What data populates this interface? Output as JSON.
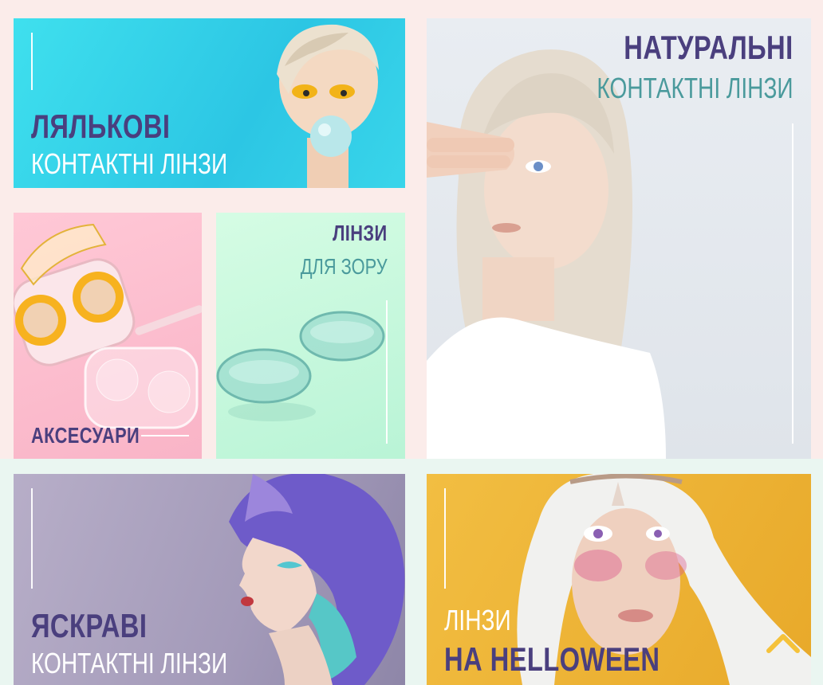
{
  "colors": {
    "title_purple": "#4a3f7e",
    "title_teal": "#4a9a9c",
    "white": "#ffffff",
    "accent_yellow": "#f5c23a"
  },
  "tiles": {
    "doll": {
      "line1": "ЛЯЛЬКОВІ",
      "line2": "КОНТАКТНІ ЛІНЗИ"
    },
    "natural": {
      "line1": "НАТУРАЛЬНІ",
      "line2": "КОНТАКТНІ ЛІНЗИ"
    },
    "accessories": {
      "line1": "АКСЕСУАРИ"
    },
    "vision": {
      "line1": "ЛІНЗИ",
      "line2": "ДЛЯ ЗОРУ"
    },
    "bright": {
      "line1": "ЯСКРАВІ",
      "line2": "КОНТАКТНІ ЛІНЗИ"
    },
    "halloween": {
      "line1": "ЛІНЗИ",
      "line2": "НА HELLOWEEN"
    }
  },
  "icons": {
    "scroll_top": "chevron-up-icon"
  }
}
